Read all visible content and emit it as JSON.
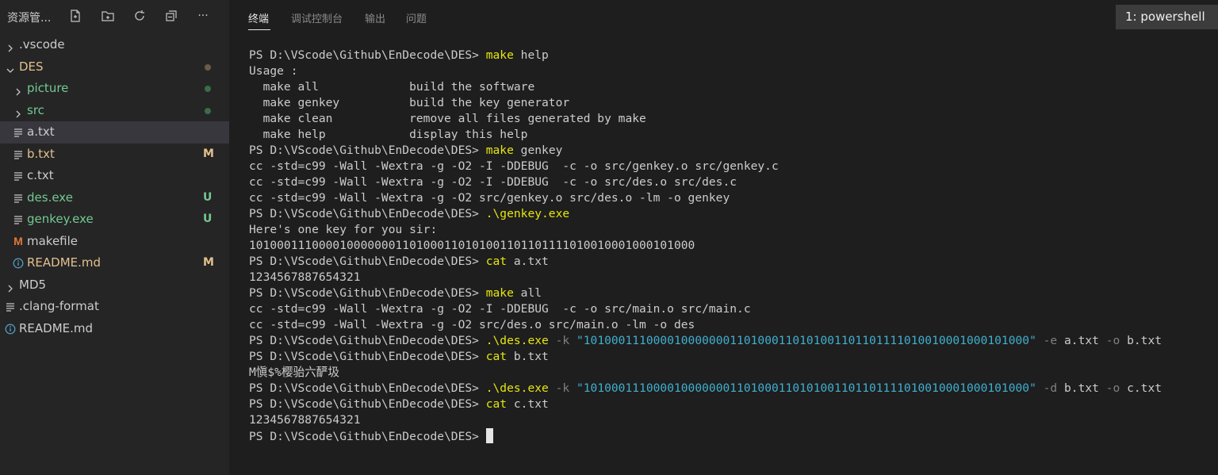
{
  "sidebar": {
    "title": "资源管...",
    "header_icons": [
      "new-file-icon",
      "new-folder-icon",
      "refresh-icon",
      "collapse-all-icon",
      "more-icon"
    ],
    "more_label": "···",
    "tree": [
      {
        "label": ".vscode",
        "kind": "folder",
        "state": "collapsed",
        "color": "#cccccc"
      },
      {
        "label": "DES",
        "kind": "folder",
        "state": "expanded",
        "color": "#e2c08d",
        "status": "dot",
        "status_color": "#6b5c46"
      },
      {
        "label": "picture",
        "kind": "folder",
        "state": "collapsed",
        "color": "#73c991",
        "status": "dot",
        "status_color": "#3b6b48"
      },
      {
        "label": "src",
        "kind": "folder",
        "state": "collapsed",
        "color": "#73c991",
        "status": "dot",
        "status_color": "#3b6b48"
      },
      {
        "label": "a.txt",
        "kind": "file",
        "color": "#cccccc",
        "selected": true
      },
      {
        "label": "b.txt",
        "kind": "file",
        "color": "#e2c08d",
        "status": "M"
      },
      {
        "label": "c.txt",
        "kind": "file",
        "color": "#cccccc"
      },
      {
        "label": "des.exe",
        "kind": "file",
        "color": "#73c991",
        "status": "U"
      },
      {
        "label": "genkey.exe",
        "kind": "file",
        "color": "#73c991",
        "status": "U"
      },
      {
        "label": "makefile",
        "kind": "makefile",
        "color": "#cccccc"
      },
      {
        "label": "README.md",
        "kind": "info",
        "color": "#e2c08d",
        "status": "M"
      },
      {
        "label": "MD5",
        "kind": "folder",
        "state": "collapsed",
        "color": "#cccccc"
      },
      {
        "label": ".clang-format",
        "kind": "file",
        "color": "#cccccc"
      },
      {
        "label": "README.md",
        "kind": "info",
        "color": "#cccccc"
      }
    ],
    "status_colors": {
      "M": "#e2c08d",
      "U": "#73c991"
    }
  },
  "panel": {
    "tabs": [
      {
        "label": "终端",
        "active": true
      },
      {
        "label": "调试控制台",
        "active": false
      },
      {
        "label": "输出",
        "active": false
      },
      {
        "label": "问题",
        "active": false
      }
    ],
    "terminal_selector": "1: powershell"
  },
  "terminal": {
    "prompt": "PS D:\\VScode\\Github\\EnDecode\\DES> ",
    "lines": [
      [
        {
          "t": "PS D:\\VScode\\Github\\EnDecode\\DES> "
        },
        {
          "t": "make",
          "c": "yel"
        },
        {
          "t": " help"
        }
      ],
      [
        {
          "t": "Usage :"
        }
      ],
      [
        {
          "t": "  make all             build the software"
        }
      ],
      [
        {
          "t": "  make genkey          build the key generator"
        }
      ],
      [
        {
          "t": "  make clean           remove all files generated by make"
        }
      ],
      [
        {
          "t": "  make help            display this help"
        }
      ],
      [
        {
          "t": "PS D:\\VScode\\Github\\EnDecode\\DES> "
        },
        {
          "t": "make",
          "c": "yel"
        },
        {
          "t": " genkey"
        }
      ],
      [
        {
          "t": "cc -std=c99 -Wall -Wextra -g -O2 -I -DDEBUG  -c -o src/genkey.o src/genkey.c"
        }
      ],
      [
        {
          "t": "cc -std=c99 -Wall -Wextra -g -O2 -I -DDEBUG  -c -o src/des.o src/des.c"
        }
      ],
      [
        {
          "t": "cc -std=c99 -Wall -Wextra -g -O2 src/genkey.o src/des.o -lm -o genkey"
        }
      ],
      [
        {
          "t": "PS D:\\VScode\\Github\\EnDecode\\DES> "
        },
        {
          "t": ".\\genkey.exe",
          "c": "yel"
        }
      ],
      [
        {
          "t": "Here's one key for you sir:"
        }
      ],
      [
        {
          "t": "1010001110000100000001101000110101001101101111010010001000101000"
        }
      ],
      [
        {
          "t": "PS D:\\VScode\\Github\\EnDecode\\DES> "
        },
        {
          "t": "cat",
          "c": "yel"
        },
        {
          "t": " a.txt"
        }
      ],
      [
        {
          "t": "1234567887654321"
        }
      ],
      [
        {
          "t": "PS D:\\VScode\\Github\\EnDecode\\DES> "
        },
        {
          "t": "make",
          "c": "yel"
        },
        {
          "t": " all"
        }
      ],
      [
        {
          "t": "cc -std=c99 -Wall -Wextra -g -O2 -I -DDEBUG  -c -o src/main.o src/main.c"
        }
      ],
      [
        {
          "t": "cc -std=c99 -Wall -Wextra -g -O2 src/des.o src/main.o -lm -o des"
        }
      ],
      [
        {
          "t": "PS D:\\VScode\\Github\\EnDecode\\DES> "
        },
        {
          "t": ".\\des.exe",
          "c": "yel"
        },
        {
          "t": " -k ",
          "c": "gry"
        },
        {
          "t": "\"1010001110000100000001101000110101001101101111010010001000101000\"",
          "c": "cyan"
        },
        {
          "t": " -e ",
          "c": "gry"
        },
        {
          "t": "a.txt"
        },
        {
          "t": " -o ",
          "c": "gry"
        },
        {
          "t": "b.txt"
        }
      ],
      [
        {
          "t": "PS D:\\VScode\\Github\\EnDecode\\DES> "
        },
        {
          "t": "cat",
          "c": "yel"
        },
        {
          "t": " b.txt"
        }
      ],
      [
        {
          "t": "M愼$%樱骀六酽圾"
        }
      ],
      [
        {
          "t": "PS D:\\VScode\\Github\\EnDecode\\DES> "
        },
        {
          "t": ".\\des.exe",
          "c": "yel"
        },
        {
          "t": " -k ",
          "c": "gry"
        },
        {
          "t": "\"1010001110000100000001101000110101001101101111010010001000101000\"",
          "c": "cyan"
        },
        {
          "t": " -d ",
          "c": "gry"
        },
        {
          "t": "b.txt"
        },
        {
          "t": " -o ",
          "c": "gry"
        },
        {
          "t": "c.txt"
        }
      ],
      [
        {
          "t": "PS D:\\VScode\\Github\\EnDecode\\DES> "
        },
        {
          "t": "cat",
          "c": "yel"
        },
        {
          "t": " c.txt"
        }
      ],
      [
        {
          "t": "1234567887654321"
        }
      ],
      [
        {
          "t": "PS D:\\VScode\\Github\\EnDecode\\DES> "
        },
        {
          "t": "",
          "cursor": true
        }
      ]
    ]
  }
}
